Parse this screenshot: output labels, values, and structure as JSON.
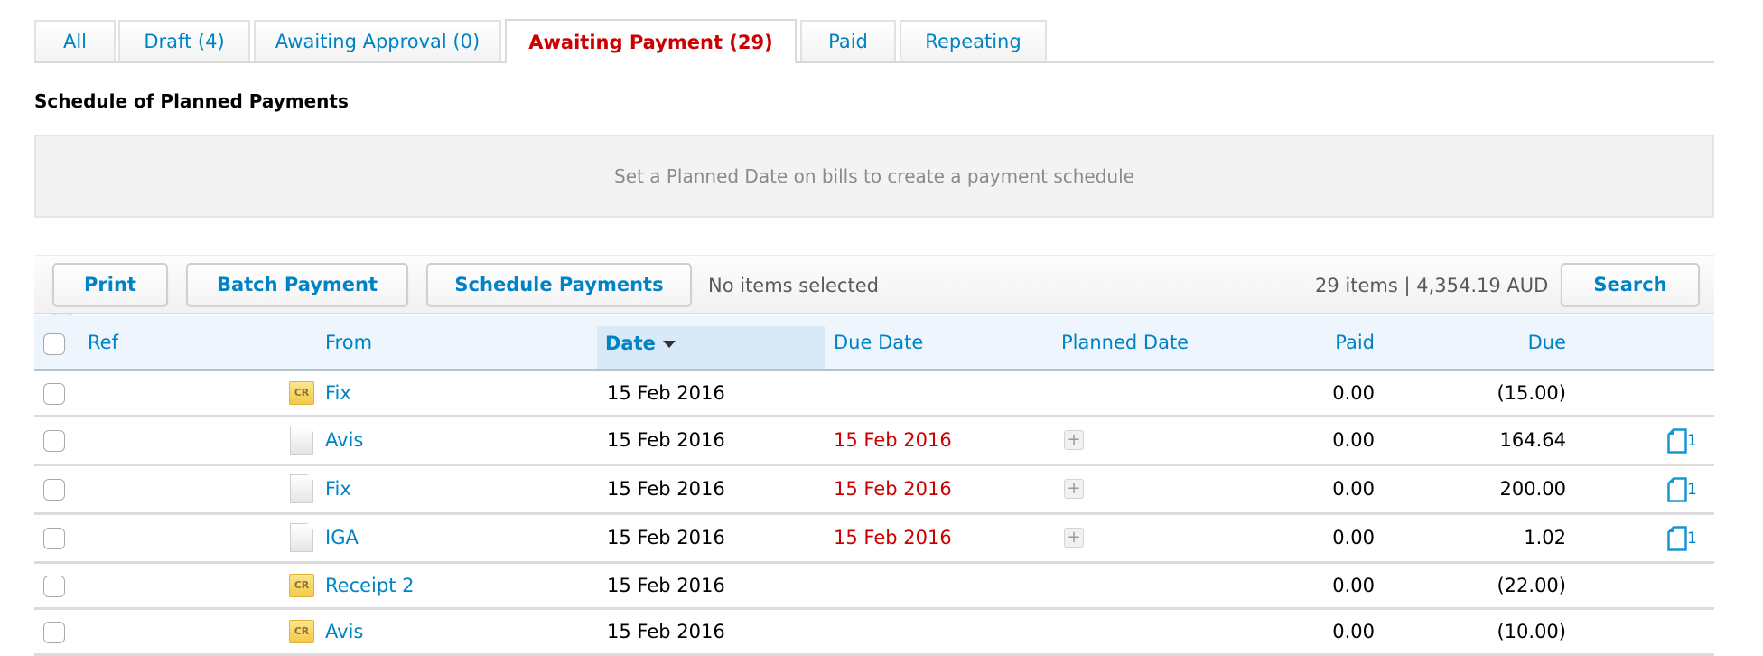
{
  "tabs": [
    {
      "label": "All",
      "active": false
    },
    {
      "label": "Draft (4)",
      "active": false
    },
    {
      "label": "Awaiting Approval (0)",
      "active": false
    },
    {
      "label": "Awaiting Payment (29)",
      "active": true
    },
    {
      "label": "Paid",
      "active": false
    },
    {
      "label": "Repeating",
      "active": false
    }
  ],
  "schedule": {
    "title": "Schedule of Planned Payments",
    "notice": "Set a Planned Date on bills to create a payment schedule"
  },
  "toolbar": {
    "print_label": "Print",
    "batch_payment_label": "Batch Payment",
    "schedule_payments_label": "Schedule Payments",
    "selection_status": "No items selected",
    "summary": "29 items | 4,354.19 AUD",
    "search_label": "Search"
  },
  "table": {
    "columns": {
      "ref": "Ref",
      "from": "From",
      "date": "Date",
      "due_date": "Due Date",
      "planned_date": "Planned Date",
      "paid": "Paid",
      "due": "Due"
    },
    "sort": {
      "column": "Date",
      "direction": "descending"
    },
    "rows": [
      {
        "ref": "",
        "type_icon": "credit-note-icon",
        "from": "Fix",
        "date": "15 Feb 2016",
        "due_date": "",
        "planned_date_add": false,
        "paid": "0.00",
        "due": "(15.00)",
        "attachments": ""
      },
      {
        "ref": "",
        "type_icon": "bill-icon",
        "from": "Avis",
        "date": "15 Feb 2016",
        "due_date": "15 Feb 2016",
        "planned_date_add": true,
        "paid": "0.00",
        "due": "164.64",
        "attachments": "1"
      },
      {
        "ref": "",
        "type_icon": "bill-icon",
        "from": "Fix",
        "date": "15 Feb 2016",
        "due_date": "15 Feb 2016",
        "planned_date_add": true,
        "paid": "0.00",
        "due": "200.00",
        "attachments": "1"
      },
      {
        "ref": "",
        "type_icon": "bill-icon",
        "from": "IGA",
        "date": "15 Feb 2016",
        "due_date": "15 Feb 2016",
        "planned_date_add": true,
        "paid": "0.00",
        "due": "1.02",
        "attachments": "1"
      },
      {
        "ref": "",
        "type_icon": "credit-note-icon",
        "from": "Receipt 2",
        "date": "15 Feb 2016",
        "due_date": "",
        "planned_date_add": false,
        "paid": "0.00",
        "due": "(22.00)",
        "attachments": ""
      },
      {
        "ref": "",
        "type_icon": "credit-note-icon",
        "from": "Avis",
        "date": "15 Feb 2016",
        "due_date": "",
        "planned_date_add": false,
        "paid": "0.00",
        "due": "(10.00)",
        "attachments": ""
      }
    ]
  },
  "icons": {
    "credit_note_glyph": "CR",
    "plus_glyph": "+"
  },
  "colors": {
    "link": "#0083c4",
    "active_tab": "#cc0000",
    "overdue": "#cc0000",
    "sorted_header_bg": "#d8e9f8"
  }
}
